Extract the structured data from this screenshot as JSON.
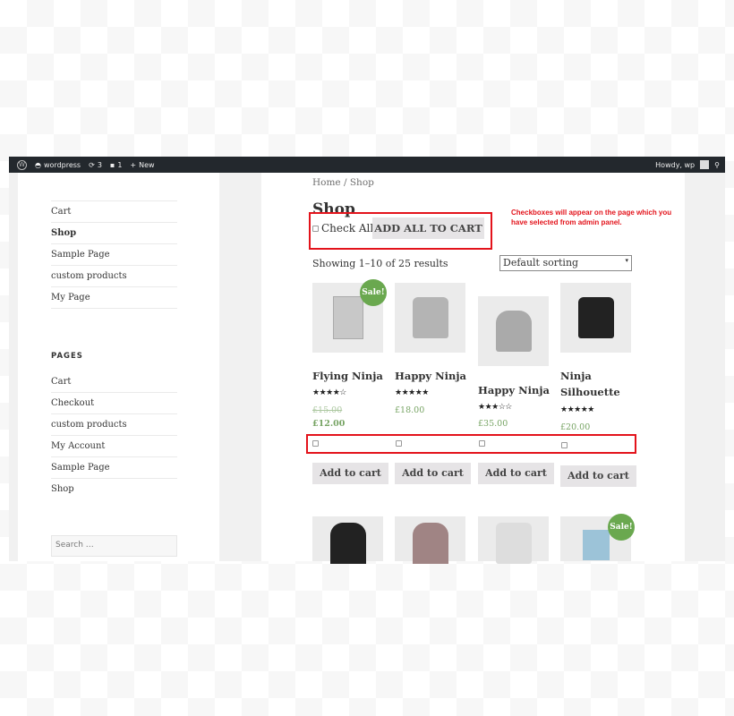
{
  "adminbar": {
    "site": "wordpress",
    "updates": "3",
    "comments": "1",
    "new": "New",
    "howdy": "Howdy, wp"
  },
  "sidebar": {
    "menu": [
      "Cart",
      "Shop",
      "Sample Page",
      "custom products",
      "My Page"
    ],
    "pages_heading": "PAGES",
    "pages": [
      "Cart",
      "Checkout",
      "custom products",
      "My Account",
      "Sample Page",
      "Shop"
    ],
    "search_placeholder": "Search …"
  },
  "main": {
    "breadcrumb": "Home / Shop",
    "title": "Shop",
    "check_all": "Check All",
    "add_all": "ADD ALL TO CART",
    "note": "Checkboxes will appear on the page which you have selected from admin panel.",
    "result_count": "Showing 1–10 of 25 results",
    "sorting": "Default sorting",
    "sale_label": "Sale!",
    "add_to_cart": "Add to cart"
  },
  "products": [
    {
      "name": "Flying Ninja",
      "rating": 4,
      "old_price": "£15.00",
      "price": "£12.00",
      "sale": true
    },
    {
      "name": "Happy Ninja",
      "rating": 5,
      "price": "£18.00"
    },
    {
      "name": "Happy Ninja",
      "rating": 3,
      "price": "£35.00"
    },
    {
      "name": "Ninja Silhouette",
      "rating": 5,
      "price": "£20.00"
    }
  ],
  "colors": {
    "accent_red": "#e3131b",
    "sale_green": "#6aa84f",
    "price_green": "#77a464",
    "adminbar": "#23282d"
  }
}
